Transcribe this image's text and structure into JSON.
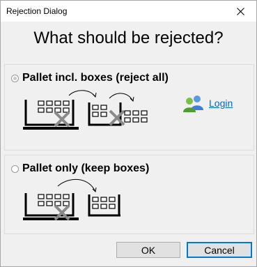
{
  "window": {
    "title": "Rejection Dialog",
    "close_glyph": "✕"
  },
  "heading": "What should be rejected?",
  "options": [
    {
      "label": "Pallet incl. boxes (reject all)",
      "selected": false
    },
    {
      "label": "Pallet only (keep boxes)",
      "selected": false
    }
  ],
  "login": {
    "label": "Login",
    "icon": "users-icon"
  },
  "buttons": {
    "ok": "OK",
    "cancel": "Cancel"
  },
  "colors": {
    "accent": "#0078d7",
    "link": "#0066cc",
    "cross": "#8a8a8a"
  }
}
